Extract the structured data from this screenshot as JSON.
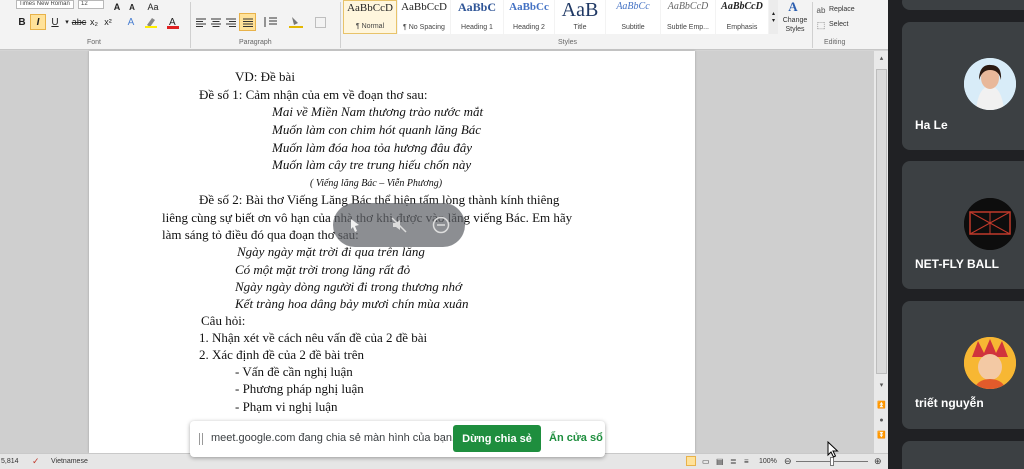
{
  "ribbon": {
    "font_name": "Times New Roman",
    "font_size": "12",
    "groups": {
      "font": "Font",
      "paragraph": "Paragraph",
      "styles": "Styles",
      "editing": "Editing"
    },
    "styles": [
      {
        "sample": "AaBbCcD",
        "name": "¶ Normal"
      },
      {
        "sample": "AaBbCcD",
        "name": "¶ No Spacing"
      },
      {
        "sample": "AaBbC",
        "name": "Heading 1"
      },
      {
        "sample": "AaBbCc",
        "name": "Heading 2"
      },
      {
        "sample": "AaB",
        "name": "Title"
      },
      {
        "sample": "AaBbCc",
        "name": "Subtitle"
      },
      {
        "sample": "AaBbCcD",
        "name": "Subtle Emp..."
      },
      {
        "sample": "AaBbCcD",
        "name": "Emphasis"
      }
    ],
    "change_styles": "Change Styles",
    "replace": "Replace",
    "select": "Select"
  },
  "document": {
    "lines": [
      "VD: Đề bài",
      "Đề số 1: Cảm nhận của em về đoạn thơ sau:",
      "Mai về Miền Nam thương trào nước mắt",
      "Muốn làm con chim hót quanh lăng Bác",
      "Muốn làm đóa hoa tỏa hương đâu đây",
      "Muốn làm cây tre trung hiếu chốn này",
      "( Viếng lăng Bác – Viễn Phương)",
      "Đề số 2: Bài thơ Viếng Lăng Bác thể hiện tấm lòng thành kính thiêng",
      "liêng cùng sự biết ơn vô hạn của nhà thơ khi được vào lăng viếng Bác. Em hãy",
      "làm sáng tỏ điều đó qua đoạn thơ sau:",
      "Ngày ngày mặt trời đi qua trên lăng",
      "Có một mặt trời trong lăng rất đỏ",
      "Ngày ngày dòng người đi trong thương nhớ",
      "Kết tràng hoa dâng bảy mươi chín mùa xuân",
      "Câu hỏi:",
      "1. Nhận xét về cách nêu vấn đề của 2 đề bài",
      "2. Xác định đề của 2 đề bài trên",
      "- Vấn đề cần nghị luận",
      "- Phương pháp nghị luận",
      "- Phạm vi nghị luận"
    ]
  },
  "status_bar": {
    "word_count": "5,814",
    "language": "Vietnamese",
    "zoom": "100%"
  },
  "share_notice": {
    "text": "meet.google.com đang chia sẻ màn hình của bạn.",
    "stop_button": "Dừng chia sẻ",
    "hide_button": "Ẩn cửa sổ"
  },
  "participants": [
    {
      "name": "Ha Le"
    },
    {
      "name": "NET-FLY BALL"
    },
    {
      "name": "triết nguyễn"
    }
  ],
  "colors": {
    "accent_green": "#1e8e3e",
    "meet_bg": "#202124",
    "tile_bg": "#3c4043"
  }
}
